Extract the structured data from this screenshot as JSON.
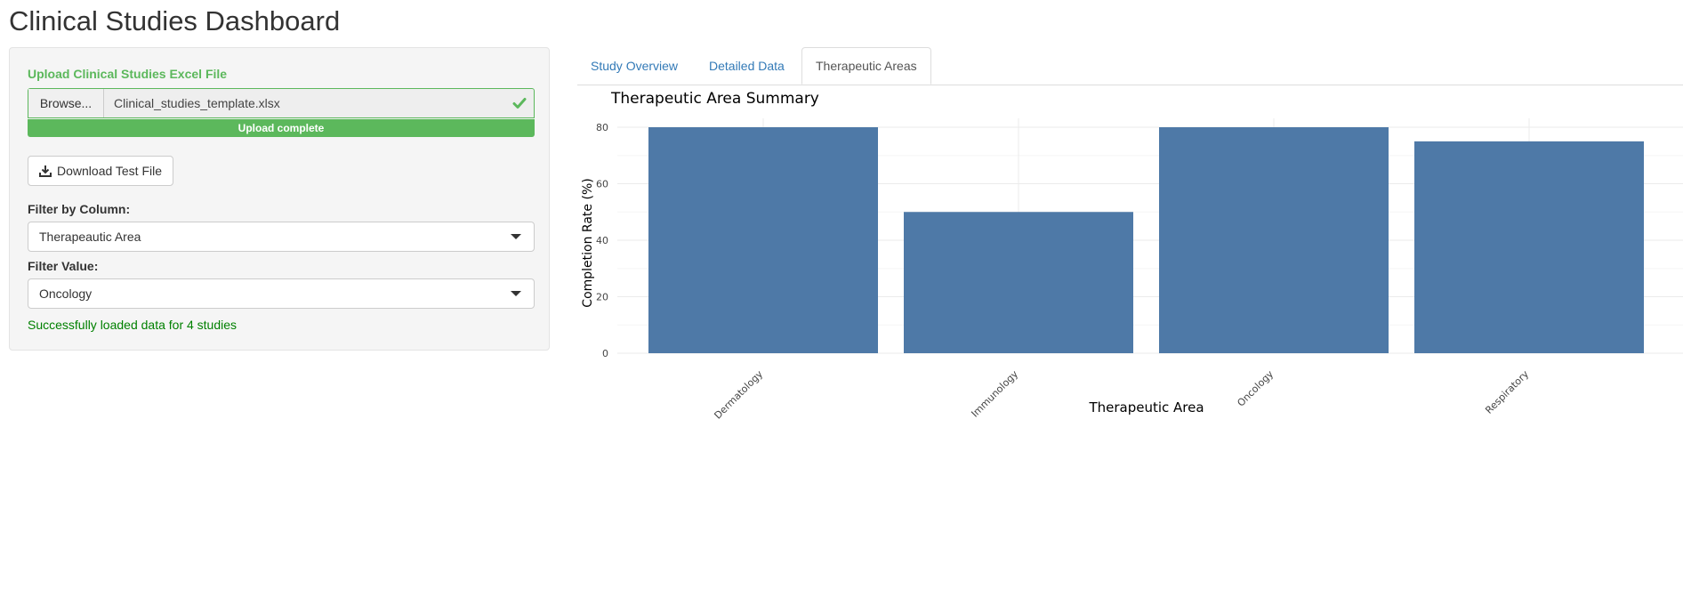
{
  "page": {
    "title": "Clinical Studies Dashboard"
  },
  "sidebar": {
    "upload_label": "Upload Clinical Studies Excel File",
    "browse_label": "Browse...",
    "file_name": "Clinical_studies_template.xlsx",
    "progress_text": "Upload complete",
    "progress_fraction": 1.0,
    "download_label": "Download Test File",
    "filter_column_label": "Filter by Column:",
    "filter_column_value": "Therapeautic Area",
    "filter_value_label": "Filter Value:",
    "filter_value_value": "Oncology",
    "status_message": "Successfully loaded data for 4 studies"
  },
  "tabs": [
    {
      "label": "Study Overview",
      "active": false
    },
    {
      "label": "Detailed Data",
      "active": false
    },
    {
      "label": "Therapeutic Areas",
      "active": true
    }
  ],
  "colors": {
    "accent_green": "#5cb85c",
    "link_blue": "#337ab7",
    "bar_fill": "#4e79a7",
    "status_green": "#008000"
  },
  "icons": {
    "file_check": "check-icon",
    "download": "download-icon",
    "select_caret": "caret-down-icon"
  },
  "chart_data": {
    "type": "bar",
    "title": "Therapeutic Area Summary",
    "xlabel": "Therapeutic Area",
    "ylabel": "Completion Rate (%)",
    "categories": [
      "Dermatology",
      "Immunology",
      "Oncology",
      "Respiratory"
    ],
    "values": [
      80,
      50,
      80,
      75
    ],
    "ylim": [
      0,
      80
    ],
    "yticks": [
      0,
      20,
      40,
      60,
      80
    ],
    "grid": true
  }
}
